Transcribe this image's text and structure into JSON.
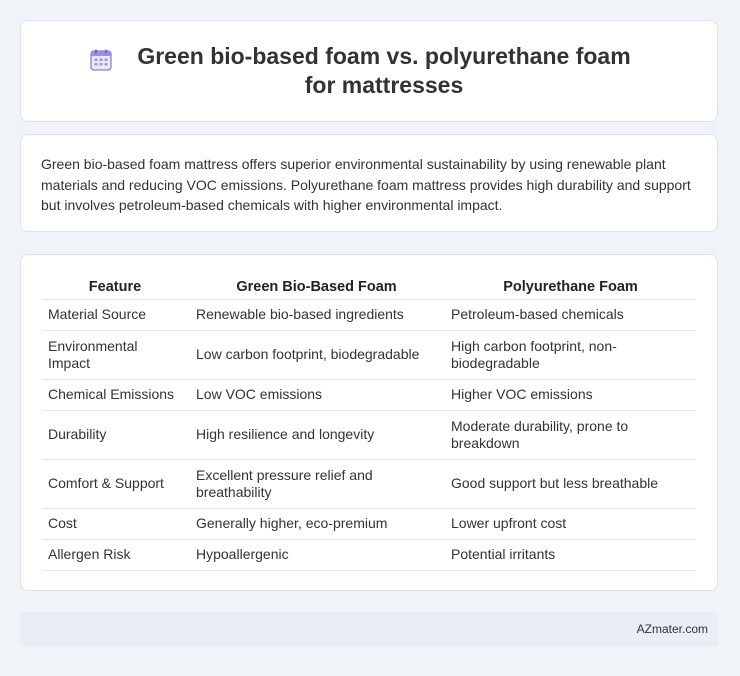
{
  "header": {
    "icon": "calendar-icon",
    "title": "Green bio-based foam vs. polyurethane foam for mattresses"
  },
  "summary": "Green bio-based foam mattress offers superior environmental sustainability by using renewable plant materials and reducing VOC emissions. Polyurethane foam mattress provides high durability and support but involves petroleum-based chemicals with higher environmental impact.",
  "table": {
    "headers": [
      "Feature",
      "Green Bio-Based Foam",
      "Polyurethane Foam"
    ],
    "rows": [
      [
        "Material Source",
        "Renewable bio-based ingredients",
        "Petroleum-based chemicals"
      ],
      [
        "Environmental Impact",
        "Low carbon footprint, biodegradable",
        "High carbon footprint, non-biodegradable"
      ],
      [
        "Chemical Emissions",
        "Low VOC emissions",
        "Higher VOC emissions"
      ],
      [
        "Durability",
        "High resilience and longevity",
        "Moderate durability, prone to breakdown"
      ],
      [
        "Comfort & Support",
        "Excellent pressure relief and breathability",
        "Good support but less breathable"
      ],
      [
        "Cost",
        "Generally higher, eco-premium",
        "Lower upfront cost"
      ],
      [
        "Allergen Risk",
        "Hypoallergenic",
        "Potential irritants"
      ]
    ]
  },
  "footer": {
    "source": "AZmater.com"
  }
}
